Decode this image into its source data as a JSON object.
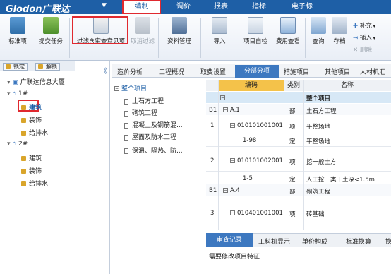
{
  "menubar": {
    "logo": "Glodon广联达",
    "logo_arrow": "▼",
    "items": [
      "编制",
      "调价",
      "报表",
      "指标",
      "电子标"
    ]
  },
  "ribbon": {
    "buttons": [
      "标准项",
      "提交任务",
      "过滤含审查意见项",
      "取消过滤",
      "资料管理",
      "导入",
      "项目自检",
      "费用查看",
      "查询",
      "存档"
    ],
    "small": [
      "补充",
      "插入",
      "删除"
    ]
  },
  "left": {
    "lock_label": "锁定",
    "unlock_label": "解锁",
    "collapse": "《",
    "root": "广联达信息大厦",
    "groups": [
      {
        "label": "1#",
        "children": [
          "建筑",
          "装饰",
          "给排水"
        ]
      },
      {
        "label": "2#",
        "children": [
          "建筑",
          "装饰",
          "给排水"
        ]
      }
    ]
  },
  "tabs": [
    "造价分析",
    "工程概况",
    "取费设置",
    "分部分项",
    "措施项目",
    "其他项目",
    "人材机汇"
  ],
  "midtree": {
    "root": "整个项目",
    "items": [
      "土石方工程",
      "砌筑工程",
      "混凝土及钢筋混...",
      "屋面及防水工程",
      "保温、隔热、防..."
    ]
  },
  "grid": {
    "headers": [
      "编码",
      "类别",
      "名称"
    ],
    "rows": [
      {
        "no": "",
        "code": "",
        "type": "",
        "name": "整个项目"
      },
      {
        "no": "B1",
        "code": "A.1",
        "type": "部",
        "name": "土石方工程"
      },
      {
        "no": "1",
        "code": "010101001001",
        "type": "项",
        "name": "平整场地"
      },
      {
        "no": "",
        "code": "1-98",
        "type": "定",
        "name": "平整场地"
      },
      {
        "no": "2",
        "code": "010101002001",
        "type": "项",
        "name": "挖一般土方"
      },
      {
        "no": "",
        "code": "1-5",
        "type": "定",
        "name": "人工挖一类干土深<1.5m"
      },
      {
        "no": "B1",
        "code": "A.4",
        "type": "部",
        "name": "砌筑工程"
      },
      {
        "no": "3",
        "code": "010401001001",
        "type": "项",
        "name": "砖基础"
      }
    ]
  },
  "bottom": {
    "tabs": [
      "审查记录",
      "工料机显示",
      "单价构成",
      "标准换算",
      "换"
    ],
    "note": "需要修改项目特征"
  }
}
